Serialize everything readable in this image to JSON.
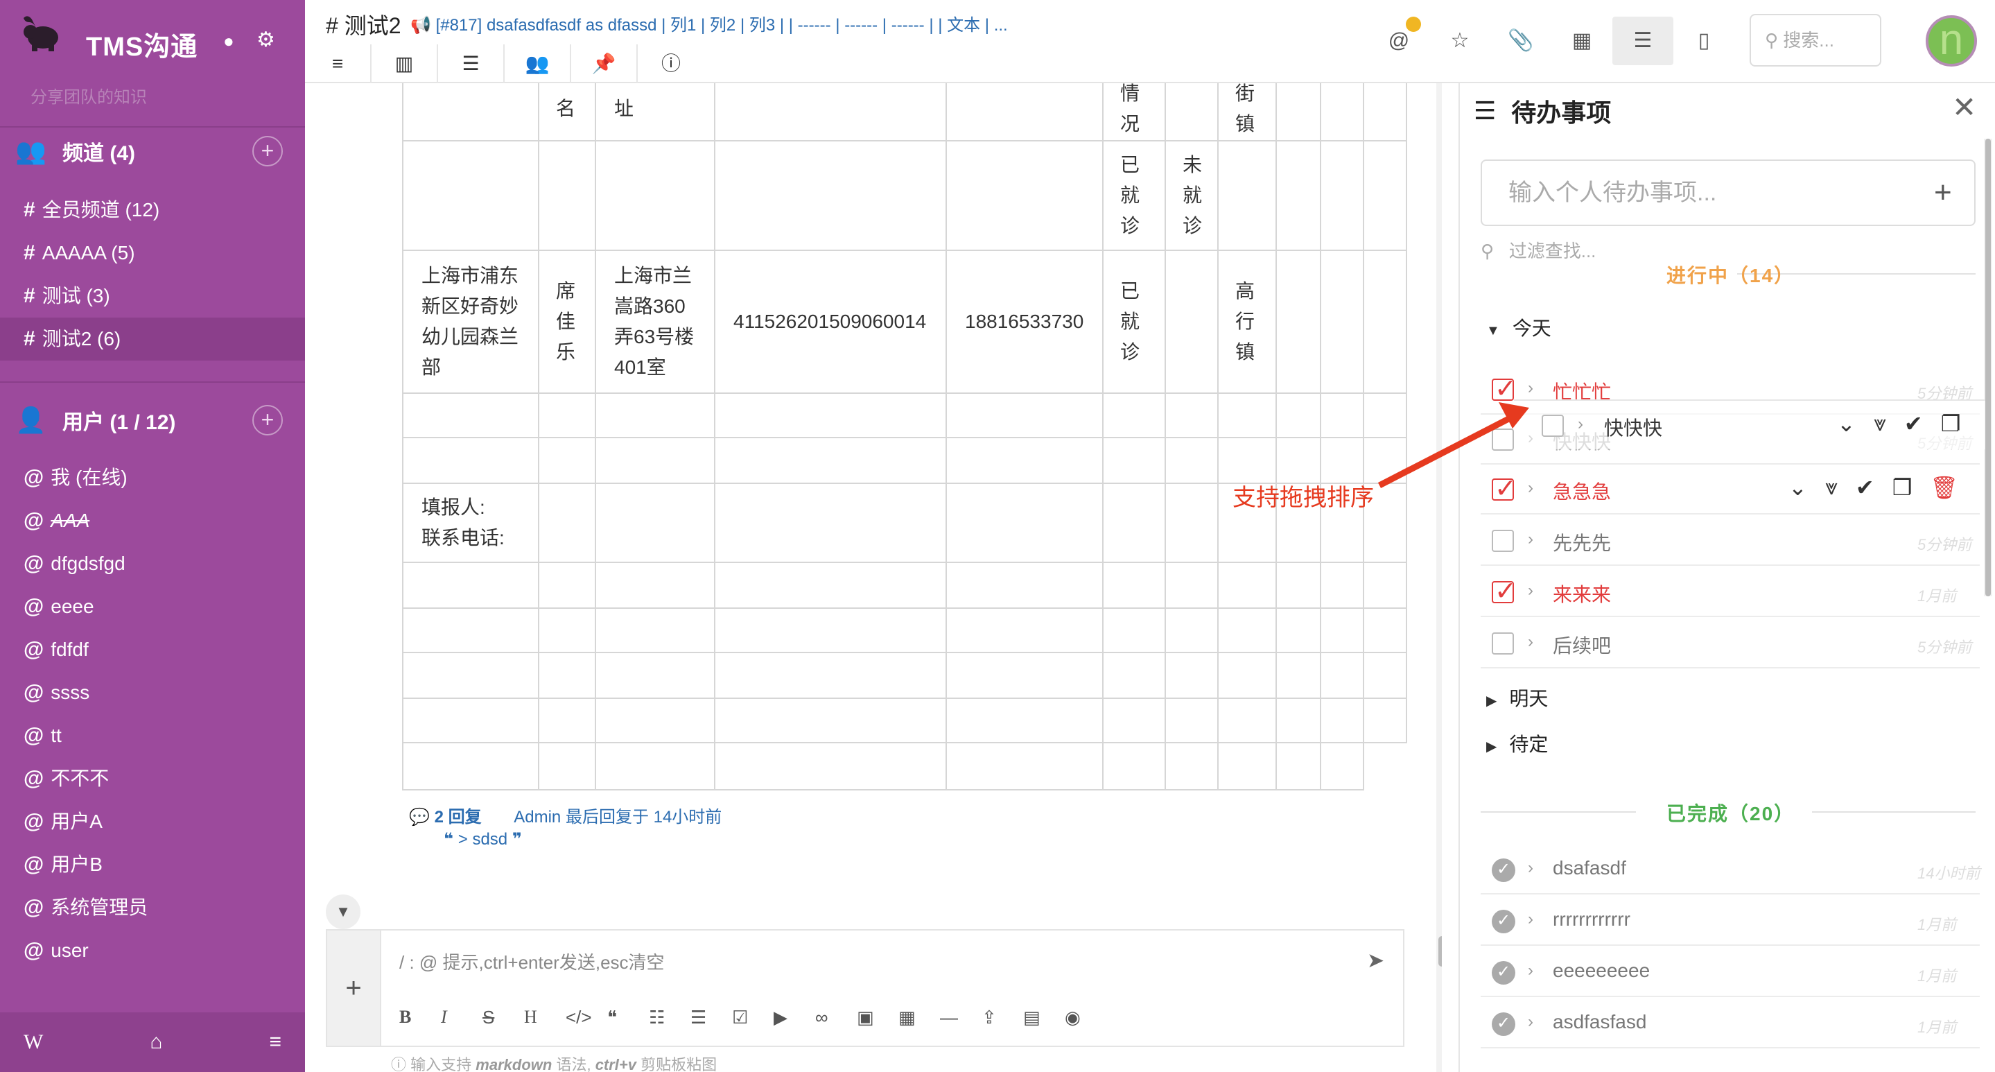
{
  "sidebar": {
    "brand": "TMS沟通",
    "subtitle": "分享团队的知识",
    "channels_header": "频道 (4)",
    "channels": [
      {
        "label": "全员频道 (12)"
      },
      {
        "label": "AAAAA (5)"
      },
      {
        "label": "测试 (3)"
      },
      {
        "label": "测试2 (6)",
        "active": true
      }
    ],
    "users_header": "用户 (1 / 12)",
    "users": [
      {
        "label": "我 (在线)"
      },
      {
        "label": "AAA",
        "strike": true
      },
      {
        "label": "dfgdsfgd"
      },
      {
        "label": "eeee"
      },
      {
        "label": "fdfdf"
      },
      {
        "label": "ssss"
      },
      {
        "label": "tt"
      },
      {
        "label": "不不不"
      },
      {
        "label": "用户A"
      },
      {
        "label": "用户B"
      },
      {
        "label": "系统管理员"
      },
      {
        "label": "user"
      }
    ],
    "footer": {
      "w": "W",
      "home": "⌂",
      "menu": "≡"
    }
  },
  "header": {
    "channel_title": "# 测试2",
    "topic": "[#817] dsafasdfasdf as dfassd | 列1 | 列2 | 列3 | | ------ | ------ | ------ | | 文本 | ...",
    "search_placeholder": "搜索...",
    "avatar_letter": "n"
  },
  "table": {
    "rows": [
      [
        "",
        "名",
        "址",
        "",
        "",
        "情况",
        "",
        "街镇",
        "",
        "",
        ""
      ],
      [
        "",
        "",
        "",
        "",
        "",
        "已就诊",
        "未就诊",
        "",
        "",
        "",
        ""
      ],
      [
        "上海市浦东新区好奇妙幼儿园森兰部",
        "席佳乐",
        "上海市兰嵩路360弄63号楼401室",
        "411526201509060014",
        "18816533730",
        "已就诊",
        "",
        "高行镇",
        "",
        "",
        ""
      ],
      [
        "",
        "",
        "",
        "",
        "",
        "",
        "",
        "",
        "",
        "",
        ""
      ],
      [
        "",
        "",
        "",
        "",
        "",
        "",
        "",
        "",
        "",
        "",
        ""
      ],
      [
        "填报人:\n联系电话:",
        "",
        "",
        "",
        "",
        "",
        "",
        "",
        "",
        "",
        ""
      ],
      [
        "",
        "",
        "",
        "",
        "",
        "",
        "",
        "",
        "",
        "",
        ""
      ],
      [
        "",
        "",
        "",
        "",
        "",
        "",
        "",
        "",
        "",
        "",
        ""
      ],
      [
        "",
        "",
        "",
        "",
        "",
        "",
        "",
        "",
        "",
        "",
        ""
      ],
      [
        "",
        "",
        "",
        "",
        "",
        "",
        "",
        "",
        "",
        "",
        ""
      ],
      [
        "",
        "",
        "",
        "",
        "",
        "",
        "",
        "",
        "",
        ""
      ]
    ]
  },
  "message": {
    "replies": "2 回复",
    "last_reply": "Admin 最后回复于 14小时前",
    "quote": "> sdsd"
  },
  "composer": {
    "placeholder": "/ : @ 提示,ctrl+enter发送,esc清空",
    "md_hint_prefix": "输入支持",
    "md_hint_md": "markdown",
    "md_hint_mid": "语法,",
    "md_hint_ctrl": "ctrl+v",
    "md_hint_suffix": "剪贴板粘图"
  },
  "annotation": {
    "text": "支持拖拽排序",
    "color": "#e63a1f"
  },
  "todo": {
    "title": "待办事项",
    "input_placeholder": "输入个人待办事项...",
    "filter_placeholder": "过滤查找...",
    "in_progress_label": "进行中（14）",
    "done_label": "已完成（20）",
    "today": "今天",
    "tomorrow": "明天",
    "pending": "待定",
    "dragging_item": "快快快",
    "items": [
      {
        "label": "忙忙忙",
        "checked": true,
        "red": true,
        "time": "5分钟前"
      },
      {
        "label": "快快快",
        "checked": false,
        "faded": true,
        "time": "5分钟前"
      },
      {
        "label": "急急急",
        "checked": true,
        "red": true,
        "time": ""
      },
      {
        "label": "先先先",
        "checked": false,
        "time": "5分钟前"
      },
      {
        "label": "来来来",
        "checked": true,
        "red": true,
        "time": "1月前"
      },
      {
        "label": "后续吧",
        "checked": false,
        "time": "5分钟前"
      }
    ],
    "done_items": [
      {
        "label": "dsafasdf",
        "time": "14小时前"
      },
      {
        "label": "rrrrrrrrrrrr",
        "time": "1月前"
      },
      {
        "label": "eeeeeeeee",
        "time": "1月前"
      },
      {
        "label": "asdfasfasd",
        "time": "1月前"
      }
    ],
    "progress_color": "#f0a24a",
    "done_color": "#4caf50"
  }
}
